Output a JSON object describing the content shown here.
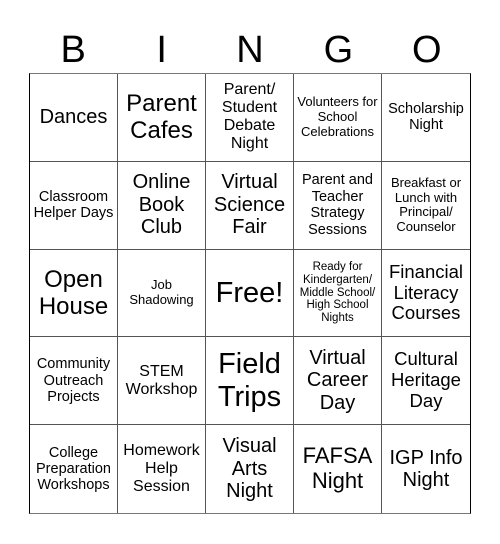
{
  "header": {
    "letters": [
      "B",
      "I",
      "N",
      "G",
      "O"
    ]
  },
  "cells": [
    [
      "Dances",
      "Parent Cafes",
      "Parent/ Student Debate Night",
      "Volunteers for School Celebrations",
      "Scholarship Night"
    ],
    [
      "Classroom Helper Days",
      "Online Book Club",
      "Virtual Science Fair",
      "Parent and Teacher Strategy Sessions",
      "Breakfast or Lunch with Principal/ Counselor"
    ],
    [
      "Open House",
      "Job Shadowing",
      "Free!",
      "Ready for Kindergarten/ Middle School/ High School Nights",
      "Financial Literacy Courses"
    ],
    [
      "Community Outreach Projects",
      "STEM Workshop",
      "Field Trips",
      "Virtual Career Day",
      "Cultural Heritage Day"
    ],
    [
      "College Preparation Workshops",
      "Homework Help Session",
      "Visual Arts Night",
      "FAFSA Night",
      "IGP Info Night"
    ]
  ]
}
